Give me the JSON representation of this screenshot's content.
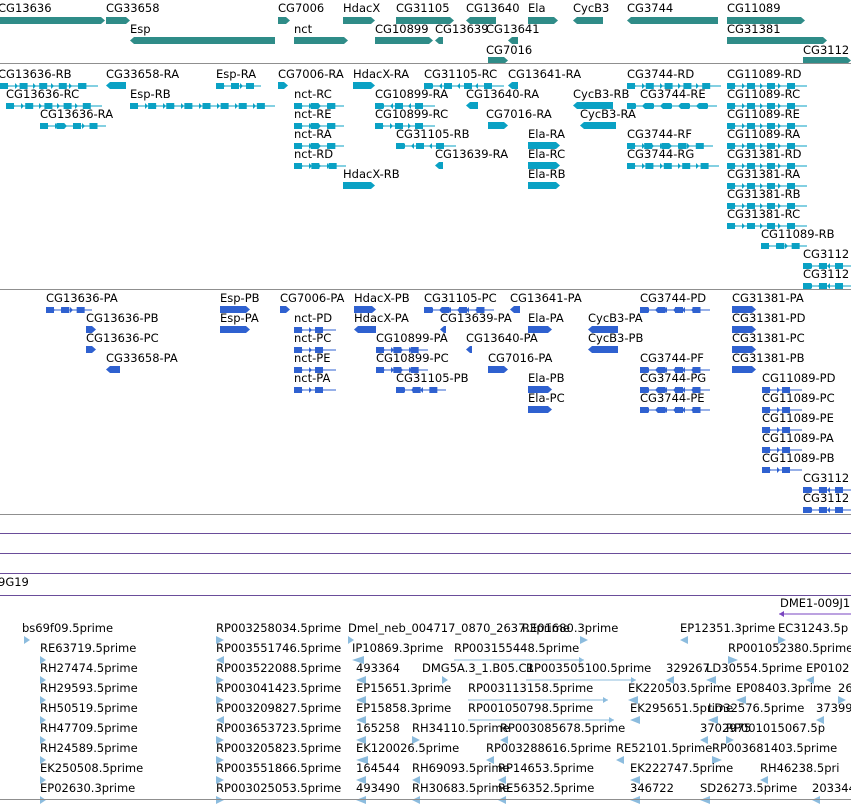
{
  "colors": {
    "gene": "#2f8c88",
    "transcript": "#0aa1c4",
    "protein": "#2f61d0",
    "est": "#8cbcde",
    "clone": "#7a45c0"
  },
  "genes": [
    {
      "label": "CG13636"
    },
    {
      "label": "CG33658"
    },
    {
      "label": "Esp"
    },
    {
      "label": "CG7006"
    },
    {
      "label": "nct"
    },
    {
      "label": "HdacX"
    },
    {
      "label": "CG31105"
    },
    {
      "label": "CG10899"
    },
    {
      "label": "CG13639"
    },
    {
      "label": "CG13640"
    },
    {
      "label": "Ela"
    },
    {
      "label": "CG13641"
    },
    {
      "label": "CG7016"
    },
    {
      "label": "CycB3"
    },
    {
      "label": "CG3744"
    },
    {
      "label": "CG11089"
    },
    {
      "label": "CG31381"
    },
    {
      "label": "CG3112"
    }
  ],
  "transcripts": [
    {
      "label": "CG13636-RB"
    },
    {
      "label": "CG33658-RA"
    },
    {
      "label": "Esp-RA"
    },
    {
      "label": "CG7006-RA"
    },
    {
      "label": "HdacX-RA"
    },
    {
      "label": "CG31105-RC"
    },
    {
      "label": "CG13641-RA"
    },
    {
      "label": "CG3744-RD"
    },
    {
      "label": "CG11089-RD"
    },
    {
      "label": "CG13636-RC"
    },
    {
      "label": "Esp-RB"
    },
    {
      "label": "nct-RC"
    },
    {
      "label": "CG10899-RA"
    },
    {
      "label": "CG13640-RA"
    },
    {
      "label": "CycB3-RB"
    },
    {
      "label": "CG3744-RE"
    },
    {
      "label": "CG11089-RC"
    },
    {
      "label": "CG13636-RA"
    },
    {
      "label": "nct-RE"
    },
    {
      "label": "CG10899-RC"
    },
    {
      "label": "CG7016-RA"
    },
    {
      "label": "CycB3-RA"
    },
    {
      "label": "CG11089-RE"
    },
    {
      "label": "nct-RA"
    },
    {
      "label": "CG31105-RB"
    },
    {
      "label": "Ela-RA"
    },
    {
      "label": "CG3744-RF"
    },
    {
      "label": "CG11089-RA"
    },
    {
      "label": "nct-RD"
    },
    {
      "label": "CG13639-RA"
    },
    {
      "label": "Ela-RC"
    },
    {
      "label": "CG3744-RG"
    },
    {
      "label": "CG31381-RD"
    },
    {
      "label": "HdacX-RB"
    },
    {
      "label": "Ela-RB"
    },
    {
      "label": "CG31381-RA"
    },
    {
      "label": "CG31381-RB"
    },
    {
      "label": "CG31381-RC"
    },
    {
      "label": "CG11089-RB"
    },
    {
      "label": "CG3112"
    },
    {
      "label": "CG3112"
    }
  ],
  "proteins": [
    {
      "label": "CG13636-PA"
    },
    {
      "label": "Esp-PB"
    },
    {
      "label": "CG7006-PA"
    },
    {
      "label": "HdacX-PB"
    },
    {
      "label": "CG31105-PC"
    },
    {
      "label": "CG13641-PA"
    },
    {
      "label": "CG3744-PD"
    },
    {
      "label": "CG31381-PA"
    },
    {
      "label": "CG13636-PB"
    },
    {
      "label": "Esp-PA"
    },
    {
      "label": "nct-PD"
    },
    {
      "label": "HdacX-PA"
    },
    {
      "label": "CG13639-PA"
    },
    {
      "label": "Ela-PA"
    },
    {
      "label": "CycB3-PA"
    },
    {
      "label": "CG31381-PD"
    },
    {
      "label": "CG13636-PC"
    },
    {
      "label": "nct-PC"
    },
    {
      "label": "CG10899-PA"
    },
    {
      "label": "CG13640-PA"
    },
    {
      "label": "CycB3-PB"
    },
    {
      "label": "CG31381-PC"
    },
    {
      "label": "CG33658-PA"
    },
    {
      "label": "nct-PE"
    },
    {
      "label": "CG10899-PC"
    },
    {
      "label": "CG7016-PA"
    },
    {
      "label": "CG3744-PF"
    },
    {
      "label": "CG31381-PB"
    },
    {
      "label": "nct-PA"
    },
    {
      "label": "CG31105-PB"
    },
    {
      "label": "Ela-PB"
    },
    {
      "label": "CG3744-PG"
    },
    {
      "label": "CG11089-PD"
    },
    {
      "label": "Ela-PC"
    },
    {
      "label": "CG3744-PE"
    },
    {
      "label": "CG11089-PC"
    },
    {
      "label": "CG11089-PE"
    },
    {
      "label": "CG11089-PA"
    },
    {
      "label": "CG11089-PB"
    },
    {
      "label": "CG3112"
    },
    {
      "label": "CG3112"
    }
  ],
  "clone_track": {
    "band_label": "9G19",
    "clone_label": "DME1-009J1"
  },
  "ests": [
    {
      "label": "bs69f09.5prime"
    },
    {
      "label": "RP003258034.5prime"
    },
    {
      "label": "Dmel_neb_004717_0870_2637.3prime"
    },
    {
      "label": "RE01680.3prime"
    },
    {
      "label": "EP12351.3prime"
    },
    {
      "label": "EC31243.5p"
    },
    {
      "label": "RE63719.5prime"
    },
    {
      "label": "RP003551746.5prime"
    },
    {
      "label": "IP10869.3prime"
    },
    {
      "label": "RP003155448.5prime"
    },
    {
      "label": "RP001052380.5prime"
    },
    {
      "label": "RH27474.5prime"
    },
    {
      "label": "RP003522088.5prime"
    },
    {
      "label": "493364"
    },
    {
      "label": "DMG5A.3_1.B05.C1"
    },
    {
      "label": "RP003505100.5prime"
    },
    {
      "label": "329267"
    },
    {
      "label": "LD30554.5prime"
    },
    {
      "label": "EP0102"
    },
    {
      "label": "RH29593.5prime"
    },
    {
      "label": "RP003041423.5prime"
    },
    {
      "label": "EP15651.3prime"
    },
    {
      "label": "RP003113158.5prime"
    },
    {
      "label": "EK220503.5prime"
    },
    {
      "label": "EP08403.3prime"
    },
    {
      "label": "26"
    },
    {
      "label": "RH50519.5prime"
    },
    {
      "label": "RP003209827.5prime"
    },
    {
      "label": "EP15858.3prime"
    },
    {
      "label": "RP001050798.5prime"
    },
    {
      "label": "EK295651.5prime"
    },
    {
      "label": "LD32576.5prime"
    },
    {
      "label": "37399"
    },
    {
      "label": "RH47709.5prime"
    },
    {
      "label": "RP003653723.5prime"
    },
    {
      "label": "165258"
    },
    {
      "label": "RH34110.5prime"
    },
    {
      "label": "RP003085678.5prime"
    },
    {
      "label": "3702975"
    },
    {
      "label": "RP001015067.5p"
    },
    {
      "label": "RH24589.5prime"
    },
    {
      "label": "RP003205823.5prime"
    },
    {
      "label": "EK120026.5prime"
    },
    {
      "label": "RP003288616.5prime"
    },
    {
      "label": "RE52101.5prime"
    },
    {
      "label": "RP003681403.5prime"
    },
    {
      "label": "EK250508.5prime"
    },
    {
      "label": "RP003551866.5prime"
    },
    {
      "label": "164544"
    },
    {
      "label": "RH69093.5prime"
    },
    {
      "label": "RP14653.5prime"
    },
    {
      "label": "EK222747.5prime"
    },
    {
      "label": "RH46238.5pri"
    },
    {
      "label": "EP02630.3prime"
    },
    {
      "label": "RP003025053.5prime"
    },
    {
      "label": "493490"
    },
    {
      "label": "RH30683.5prime"
    },
    {
      "label": "RE56352.5prime"
    },
    {
      "label": "346722"
    },
    {
      "label": "SD26273.5prime"
    },
    {
      "label": "203344"
    }
  ]
}
